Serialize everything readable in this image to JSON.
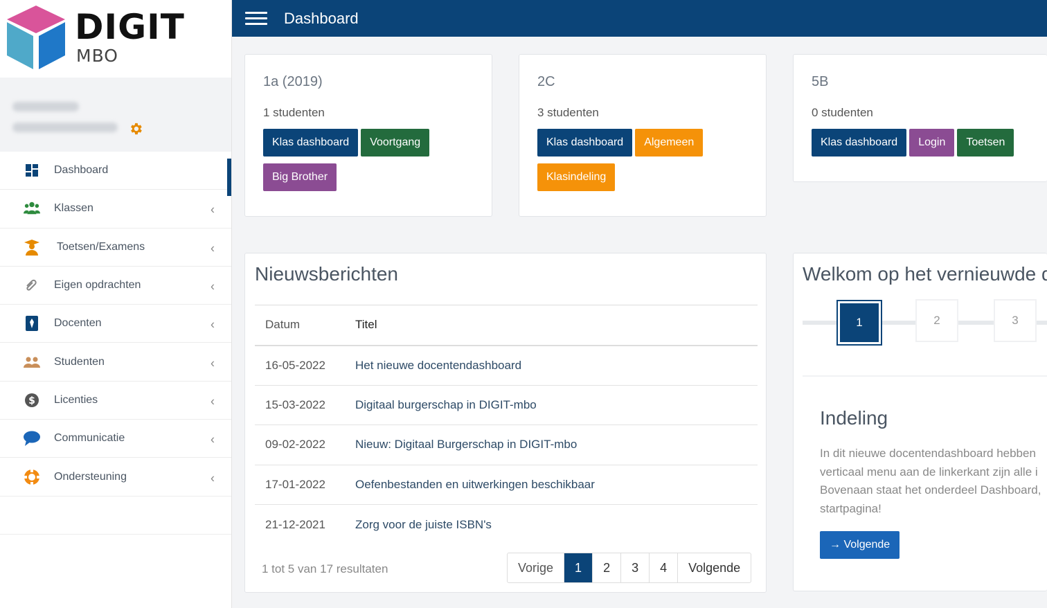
{
  "logo": {
    "title": "DIGIT",
    "subtitle": "MBO"
  },
  "header": {
    "title": "Dashboard"
  },
  "sidebar": {
    "items": [
      {
        "label": "Dashboard",
        "icon": "dashboard-icon"
      },
      {
        "label": "Klassen",
        "icon": "users-icon"
      },
      {
        "label": "Toetsen/Examens",
        "icon": "graduate-icon"
      },
      {
        "label": "Eigen opdrachten",
        "icon": "paperclip-icon"
      },
      {
        "label": "Docenten",
        "icon": "teacher-icon"
      },
      {
        "label": "Studenten",
        "icon": "students-icon"
      },
      {
        "label": "Licenties",
        "icon": "dollar-icon"
      },
      {
        "label": "Communicatie",
        "icon": "chat-icon"
      },
      {
        "label": "Ondersteuning",
        "icon": "lifebuoy-icon"
      }
    ]
  },
  "classes": [
    {
      "name": "1a (2019)",
      "count": "1 studenten",
      "buttons": [
        "Klas dashboard",
        "Voortgang",
        "Big Brother"
      ]
    },
    {
      "name": "2C",
      "count": "3 studenten",
      "buttons": [
        "Klas dashboard",
        "Algemeen",
        "Klasindeling"
      ]
    },
    {
      "name": "5B",
      "count": "0 studenten",
      "buttons": [
        "Klas dashboard",
        "Login",
        "Toetsen"
      ]
    }
  ],
  "news": {
    "title": "Nieuwsberichten",
    "columns": [
      "Datum",
      "Titel"
    ],
    "rows": [
      {
        "date": "16-05-2022",
        "title": "Het nieuwe docentendashboard"
      },
      {
        "date": "15-03-2022",
        "title": "Digitaal burgerschap in DIGIT-mbo"
      },
      {
        "date": "09-02-2022",
        "title": "Nieuw: Digitaal Burgerschap in DIGIT-mbo"
      },
      {
        "date": "17-01-2022",
        "title": "Oefenbestanden en uitwerkingen beschikbaar"
      },
      {
        "date": "21-12-2021",
        "title": "Zorg voor de juiste ISBN's"
      }
    ],
    "results": "1 tot 5 van 17 resultaten",
    "pagination": {
      "prev": "Vorige",
      "pages": [
        "1",
        "2",
        "3",
        "4"
      ],
      "next": "Volgende"
    }
  },
  "welcome": {
    "title": "Welkom op het vernieuwde d",
    "steps": [
      "1",
      "2",
      "3"
    ],
    "section_title": "Indeling",
    "text_lines": [
      "In dit nieuwe docentendashboard hebben",
      "verticaal menu aan de linkerkant zijn alle i",
      "Bovenaan staat het onderdeel Dashboard,",
      "startpagina!"
    ],
    "next_button": "→ Volgende"
  },
  "colors": {
    "primary": "#0b4478",
    "green": "#236b3d",
    "purple": "#8b4c93",
    "orange": "#f59209",
    "accent": "#e68a00"
  }
}
